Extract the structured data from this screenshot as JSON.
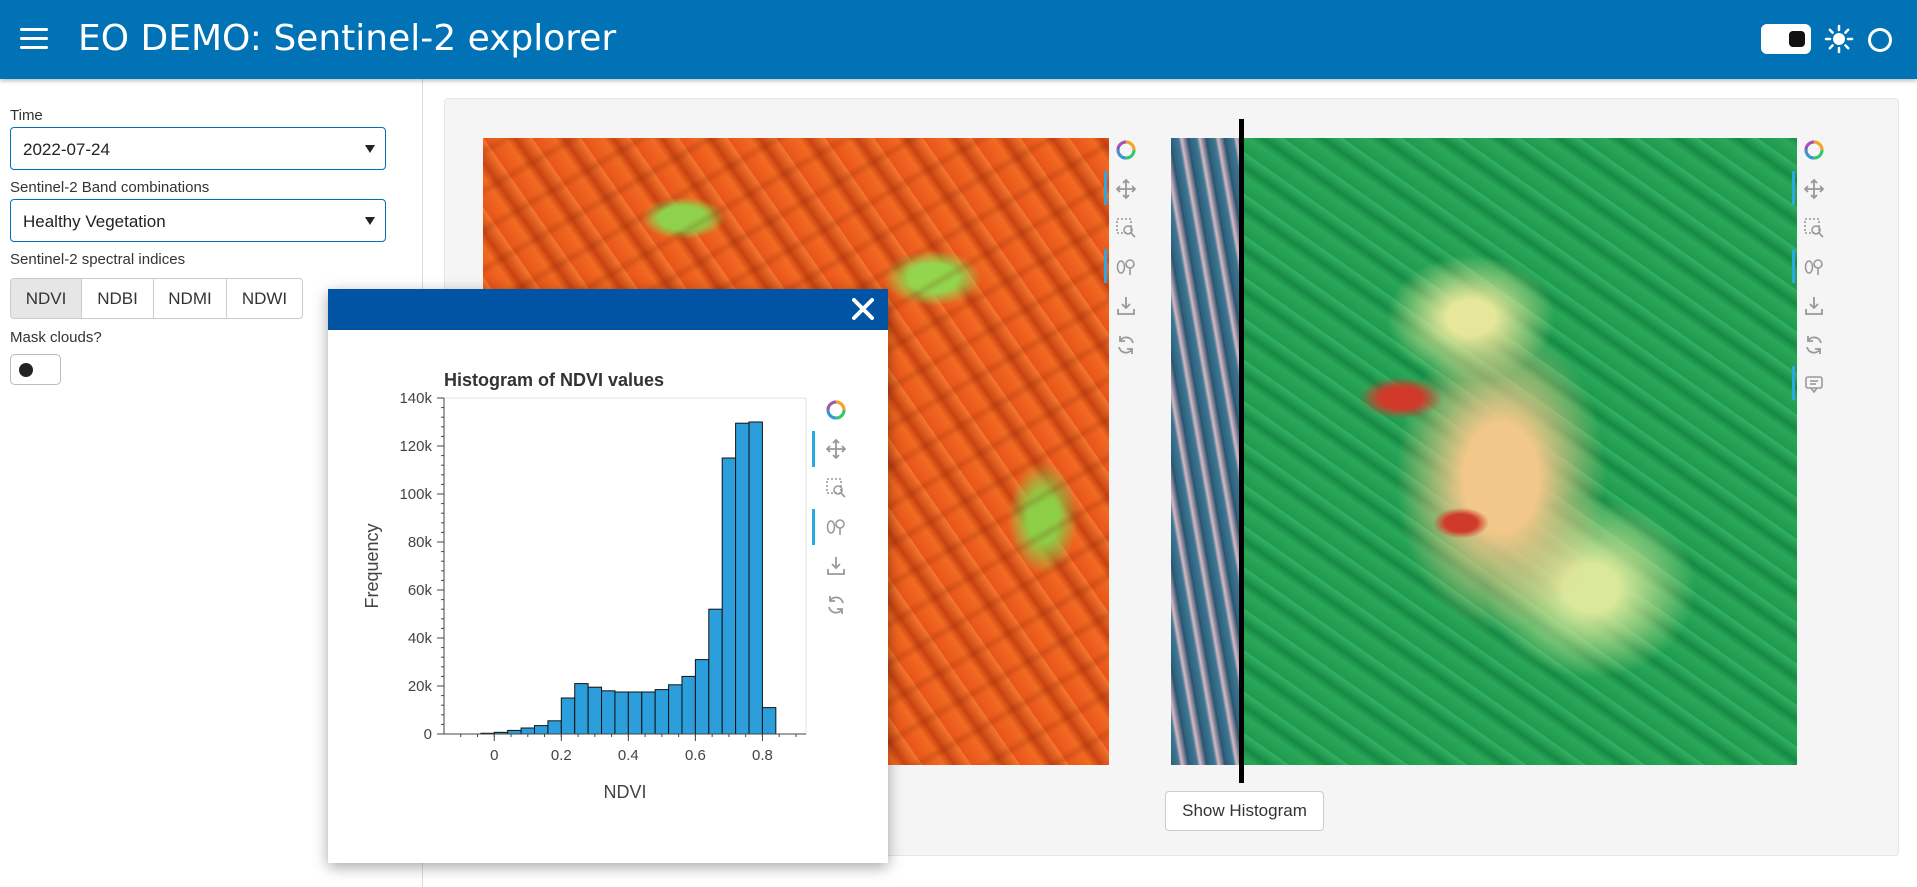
{
  "header": {
    "title": "EO DEMO: Sentinel-2 explorer",
    "bg_color": "#0072b5",
    "icons": [
      "menu-icon",
      "toggle-switch",
      "sun-icon",
      "circle-icon"
    ]
  },
  "sidebar": {
    "time_label": "Time",
    "time_value": "2022-07-24",
    "band_label": "Sentinel-2 Band combinations",
    "band_value": "Healthy Vegetation",
    "indices_label": "Sentinel-2 spectral indices",
    "indices": [
      "NDVI",
      "NDBI",
      "NDMI",
      "NDWI"
    ],
    "selected_index": "NDVI",
    "mask_label": "Mask clouds?"
  },
  "main": {
    "show_histogram_label": "Show Histogram"
  },
  "toolbar_tools": [
    "bokeh-logo-icon",
    "pan-icon",
    "box-zoom-icon",
    "wheel-zoom-icon",
    "save-icon",
    "reset-icon"
  ],
  "chart_data": {
    "type": "bar",
    "title": "Histogram of NDVI values",
    "xlabel": "NDVI",
    "ylabel": "Frequency",
    "xlim": [
      -0.15,
      0.93
    ],
    "ylim": [
      0,
      140000
    ],
    "x_ticks": [
      "0",
      "0.2",
      "0.4",
      "0.6",
      "0.8"
    ],
    "x_tick_values": [
      0,
      0.2,
      0.4,
      0.6,
      0.8
    ],
    "y_ticks": [
      "0",
      "20k",
      "40k",
      "60k",
      "80k",
      "100k",
      "120k",
      "140k"
    ],
    "y_tick_values": [
      0,
      20000,
      40000,
      60000,
      80000,
      100000,
      120000,
      140000
    ],
    "bin_width": 0.04,
    "bin_starts": [
      -0.04,
      0.0,
      0.04,
      0.08,
      0.12,
      0.16,
      0.2,
      0.24,
      0.28,
      0.32,
      0.36,
      0.4,
      0.44,
      0.48,
      0.52,
      0.56,
      0.6,
      0.64,
      0.68,
      0.72,
      0.76,
      0.8
    ],
    "values": [
      300,
      700,
      1500,
      2500,
      3500,
      5500,
      15000,
      21000,
      19500,
      18000,
      17500,
      17500,
      17500,
      18500,
      20500,
      24000,
      31000,
      52000,
      115000,
      129500,
      130000,
      11000
    ],
    "bar_color": "#2c9edb"
  }
}
